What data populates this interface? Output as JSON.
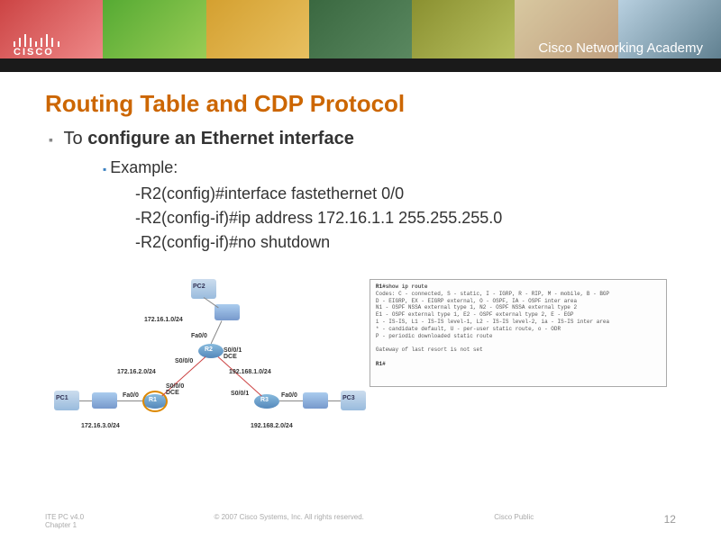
{
  "header": {
    "academy_text": "Cisco Networking Academy",
    "cisco_label": "CISCO"
  },
  "slide": {
    "title": "Routing Table and CDP Protocol",
    "bullet_prefix": "To ",
    "bullet_main": "configure an Ethernet interface",
    "example_label": "Example:",
    "cmd1": "-R2(config)#interface fastethernet 0/0",
    "cmd2": "-R2(config-if)#ip address 172.16.1.1 255.255.255.0",
    "cmd3": "-R2(config-if)#no shutdown"
  },
  "topology": {
    "pc1": "PC1",
    "pc2": "PC2",
    "pc3": "PC3",
    "r1": "R1",
    "r2": "R2",
    "r3": "R3",
    "net_top": "172.16.1.0/24",
    "net_left_mid": "172.16.2.0/24",
    "net_right_mid": "192.168.1.0/24",
    "net_left_bot": "172.16.3.0/24",
    "net_right_bot": "192.168.2.0/24",
    "fa00": "Fa0/0",
    "s000": "S0/0/0",
    "s001": "S0/0/1",
    "s001_dce": "S0/0/1\nDCE",
    "s000_dce": "S0/0/0\nDCE"
  },
  "cli": {
    "prompt": "R1#",
    "cmd": "show ip route",
    "line1": "Codes: C - connected, S - static, I - IGRP, R - RIP, M - mobile, B - BGP",
    "line2": "       D - EIGRP, EX - EIGRP external, O - OSPF, IA - OSPF inter area",
    "line3": "       N1 - OSPF NSSA external type 1, N2 - OSPF NSSA external type 2",
    "line4": "       E1 - OSPF external type 1, E2 - OSPF external type 2, E - EGP",
    "line5": "       i - IS-IS, L1 - IS-IS level-1, L2 - IS-IS level-2, ia - IS-IS inter area",
    "line6": "       * - candidate default, U - per-user static route, o - ODR",
    "line7": "       P - periodic downloaded static route",
    "gateway": "Gateway of last resort is not set",
    "prompt2": "R1#"
  },
  "footer": {
    "left1": "ITE PC v4.0",
    "left2": "Chapter 1",
    "center": "© 2007 Cisco Systems, Inc. All rights reserved.",
    "right": "Cisco Public",
    "page": "12"
  }
}
